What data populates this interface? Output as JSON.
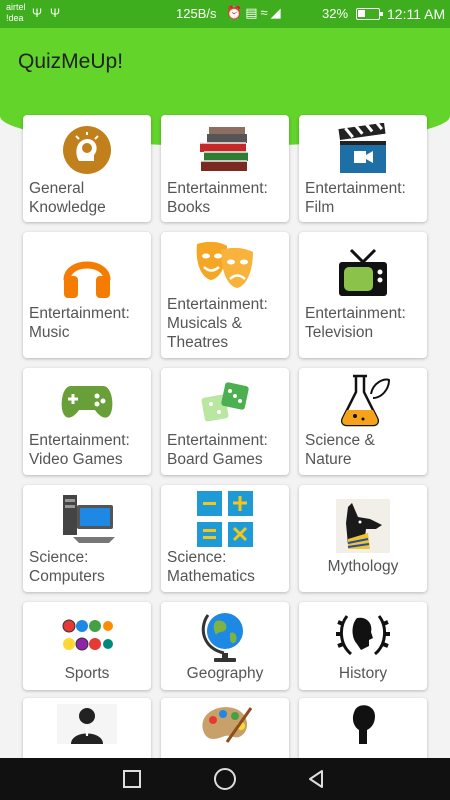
{
  "status_bar": {
    "carrier_line1": "airtel",
    "carrier_line2": "!dea",
    "net_speed": "125B/s",
    "battery": "32%",
    "time": "12:11 AM"
  },
  "app_bar": {
    "title": "QuizMeUp!"
  },
  "categories": [
    {
      "label": "General Knowledge",
      "line1": "General",
      "line2": "Knowledge",
      "icon": "lightbulb-head-icon"
    },
    {
      "label": "Entertainment: Books",
      "line1": "Entertainment:",
      "line2": "Books",
      "icon": "books-icon"
    },
    {
      "label": "Entertainment: Film",
      "line1": "Entertainment:",
      "line2": "Film",
      "icon": "film-clapper-icon"
    },
    {
      "label": "Entertainment: Music",
      "line1": "Entertainment:",
      "line2": "Music",
      "icon": "headphones-icon"
    },
    {
      "label": "Entertainment: Musicals & Theatres",
      "line1": "Entertainment:",
      "line2": "Musicals &",
      "line3": "Theatres",
      "icon": "theatre-masks-icon"
    },
    {
      "label": "Entertainment: Television",
      "line1": "Entertainment:",
      "line2": "Television",
      "icon": "television-icon"
    },
    {
      "label": "Entertainment: Video Games",
      "line1": "Entertainment:",
      "line2": "Video Games",
      "icon": "gamepad-icon"
    },
    {
      "label": "Entertainment: Board Games",
      "line1": "Entertainment:",
      "line2": "Board Games",
      "icon": "dice-icon"
    },
    {
      "label": "Science & Nature",
      "line1": "Science &",
      "line2": "Nature",
      "icon": "flask-leaf-icon"
    },
    {
      "label": "Science: Computers",
      "line1": "Science:",
      "line2": "Computers",
      "icon": "computer-icon"
    },
    {
      "label": "Science: Mathematics",
      "line1": "Science:",
      "line2": "Mathematics",
      "icon": "math-operators-icon"
    },
    {
      "label": "Mythology",
      "icon": "anubis-icon"
    },
    {
      "label": "Sports",
      "icon": "sports-balls-icon"
    },
    {
      "label": "Geography",
      "icon": "globe-icon"
    },
    {
      "label": "History",
      "icon": "laurel-head-icon"
    },
    {
      "label": "",
      "icon": "person-desk-icon"
    },
    {
      "label": "",
      "icon": "palette-icon"
    },
    {
      "label": "",
      "icon": "silhouette-icon"
    }
  ],
  "colors": {
    "status_bar": "#3fae1e",
    "app_bar": "#62d42a",
    "background": "#f3f3f3"
  }
}
